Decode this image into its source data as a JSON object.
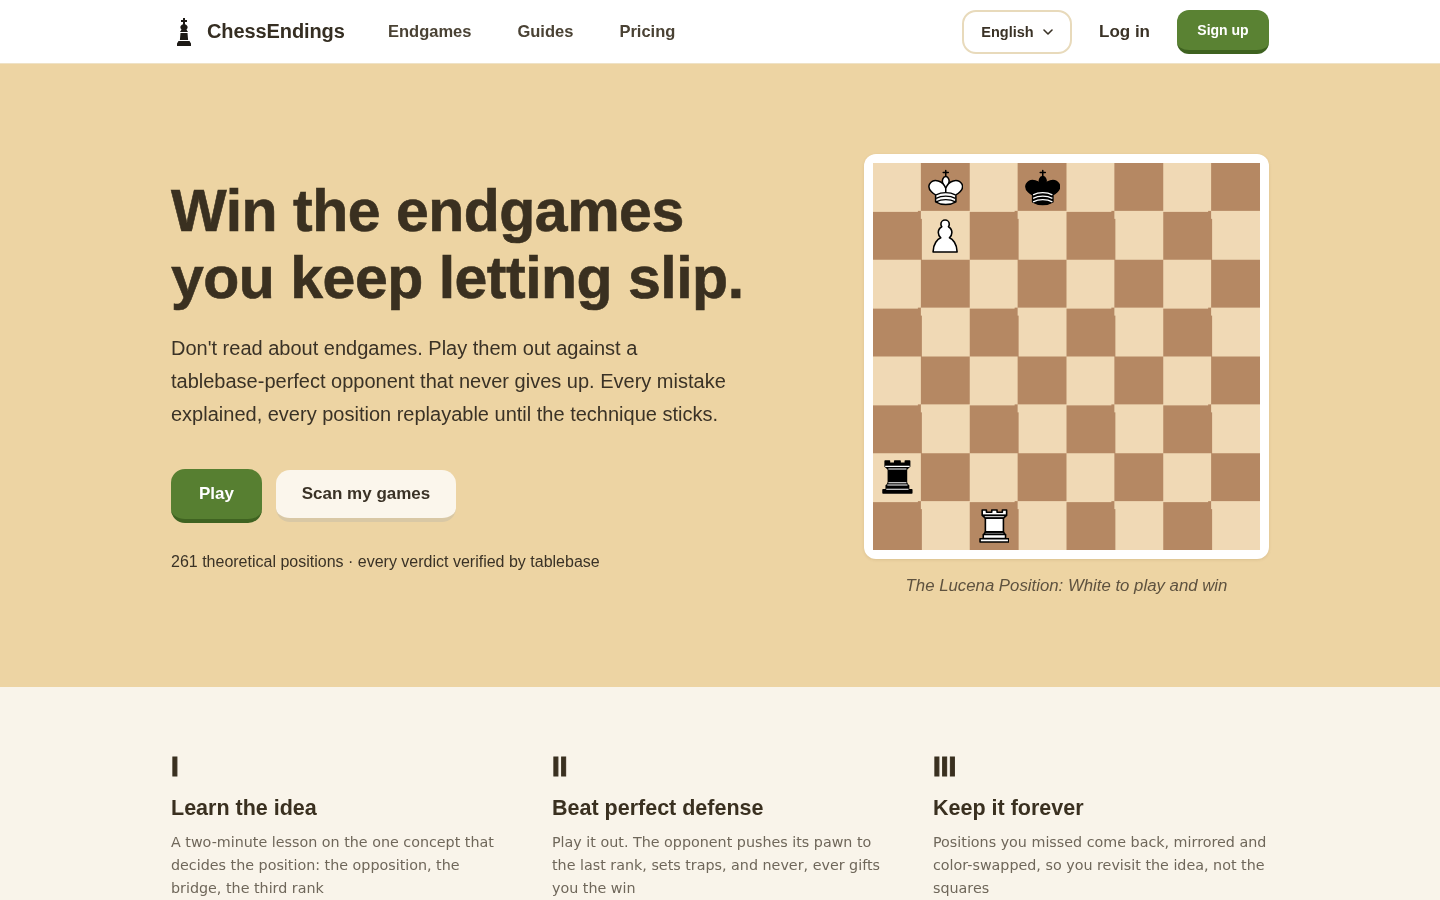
{
  "nav": {
    "brand": "ChessEndings",
    "links": [
      {
        "label": "Endgames"
      },
      {
        "label": "Guides"
      },
      {
        "label": "Pricing"
      }
    ],
    "language": {
      "label": "English"
    },
    "login": {
      "label": "Log in"
    },
    "signup": {
      "label": "Sign up"
    }
  },
  "hero": {
    "title_lines": [
      "Win the endgames",
      "you keep letting slip."
    ],
    "description": "Don't read about endgames. Play them out against a tablebase-perfect opponent that never gives up. Every mistake explained, every position replayable until the technique sticks.",
    "buttons": [
      {
        "label": "Play",
        "kind": "primary"
      },
      {
        "label": "Scan my games",
        "kind": "secondary"
      }
    ],
    "stat": "261 theoretical positions · every verdict verified by tablebase"
  },
  "board": {
    "ranks": [
      [
        {
          "kind": "empty"
        },
        {
          "kind": "king",
          "white": true
        },
        {
          "kind": "empty"
        },
        {
          "kind": "king",
          "white": false
        },
        {
          "kind": "empty"
        },
        {
          "kind": "empty"
        },
        {
          "kind": "empty"
        },
        {
          "kind": "empty"
        }
      ],
      [
        {
          "kind": "empty"
        },
        {
          "kind": "pawn",
          "white": true
        },
        {
          "kind": "empty"
        },
        {
          "kind": "empty"
        },
        {
          "kind": "empty"
        },
        {
          "kind": "empty"
        },
        {
          "kind": "empty"
        },
        {
          "kind": "empty"
        }
      ],
      [
        {
          "kind": "empty"
        },
        {
          "kind": "empty"
        },
        {
          "kind": "empty"
        },
        {
          "kind": "empty"
        },
        {
          "kind": "empty"
        },
        {
          "kind": "empty"
        },
        {
          "kind": "empty"
        },
        {
          "kind": "empty"
        }
      ],
      [
        {
          "kind": "empty"
        },
        {
          "kind": "empty"
        },
        {
          "kind": "empty"
        },
        {
          "kind": "empty"
        },
        {
          "kind": "empty"
        },
        {
          "kind": "empty"
        },
        {
          "kind": "empty"
        },
        {
          "kind": "empty"
        }
      ],
      [
        {
          "kind": "empty"
        },
        {
          "kind": "empty"
        },
        {
          "kind": "empty"
        },
        {
          "kind": "empty"
        },
        {
          "kind": "empty"
        },
        {
          "kind": "empty"
        },
        {
          "kind": "empty"
        },
        {
          "kind": "empty"
        }
      ],
      [
        {
          "kind": "empty"
        },
        {
          "kind": "empty"
        },
        {
          "kind": "empty"
        },
        {
          "kind": "empty"
        },
        {
          "kind": "empty"
        },
        {
          "kind": "empty"
        },
        {
          "kind": "empty"
        },
        {
          "kind": "empty"
        }
      ],
      [
        {
          "kind": "rook",
          "white": false
        },
        {
          "kind": "empty"
        },
        {
          "kind": "empty"
        },
        {
          "kind": "empty"
        },
        {
          "kind": "empty"
        },
        {
          "kind": "empty"
        },
        {
          "kind": "empty"
        },
        {
          "kind": "empty"
        }
      ],
      [
        {
          "kind": "empty"
        },
        {
          "kind": "empty"
        },
        {
          "kind": "rook",
          "white": true
        },
        {
          "kind": "empty"
        },
        {
          "kind": "empty"
        },
        {
          "kind": "empty"
        },
        {
          "kind": "empty"
        },
        {
          "kind": "empty"
        }
      ]
    ],
    "caption": "The Lucena Position: White to play and win"
  },
  "features": [
    {
      "numeral": "I",
      "title": "Learn the idea",
      "text": "A two-minute lesson on the one concept that decides the position: the opposition, the bridge, the third rank"
    },
    {
      "numeral": "II",
      "title": "Beat perfect defense",
      "text": "Play it out. The opponent pushes its pawn to the last rank, sets traps, and never, ever gifts you the win"
    },
    {
      "numeral": "III",
      "title": "Keep it forever",
      "text": "Positions you missed come back, mirrored and color-swapped, so you revisit the idea, not the squares"
    }
  ]
}
